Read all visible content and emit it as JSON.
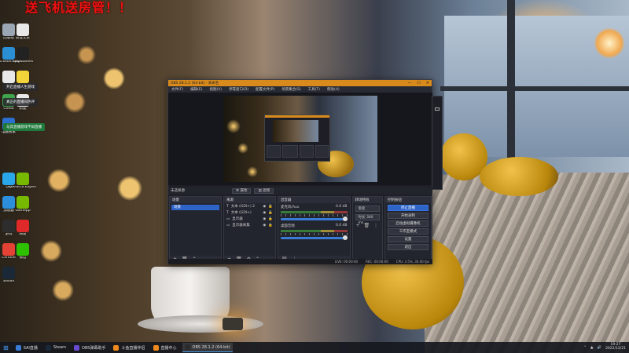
{
  "desktop": {
    "banner": "送飞机送房管！！",
    "icons": [
      {
        "label": "回收站",
        "color": "#9aa6b4"
      },
      {
        "label": "新建文本",
        "color": "#e8e8e8"
      },
      {
        "label": "Microsoft Edge",
        "color": "#2b8fd6"
      },
      {
        "label": "Epic Games",
        "color": "#222222"
      },
      {
        "label": "文件",
        "color": "#e8e8e8"
      },
      {
        "label": "文件",
        "color": "#f2d33a"
      },
      {
        "label": "Cheat",
        "color": "#3fa34d"
      },
      {
        "label": "新建",
        "color": "#e8e8e8"
      },
      {
        "label": "电脑管家",
        "color": "#2c6fcf"
      },
      {
        "label": "QQ",
        "color": "#2aa7e8"
      },
      {
        "label": "GeForce Experience",
        "color": "#76b900"
      },
      {
        "label": "加速器",
        "color": "#2d8fdc"
      },
      {
        "label": "Gamepp",
        "color": "#76b900"
      },
      {
        "label": "游戏",
        "color": "#2d2d2d"
      },
      {
        "label": "网易",
        "color": "#e02a2a"
      },
      {
        "label": "Chrome",
        "color": "#e34234"
      },
      {
        "label": "微信",
        "color": "#2dc100"
      },
      {
        "label": "Steam",
        "color": "#1b2838"
      }
    ],
    "notifications": [
      {
        "text": "开启直播人生游戏",
        "on": false
      },
      {
        "text": "真正的直播间热评",
        "on": false
      },
      {
        "text": "与其直播游戏不如直播",
        "on": true
      }
    ]
  },
  "obs": {
    "title": "OBS 28.1.2 (64-bit) - 未命名",
    "window_controls": [
      "—",
      "☐",
      "✕"
    ],
    "menu": [
      "文件(F)",
      "编辑(E)",
      "视图(V)",
      "停靠窗口(D)",
      "配置文件(P)",
      "场景集合(S)",
      "工具(T)",
      "帮助(H)"
    ],
    "scene_label": "未选择源",
    "toolbar_buttons": [
      "属性",
      "滤镜"
    ],
    "docks": {
      "scenes": {
        "title": "场景",
        "items": [
          "场景"
        ]
      },
      "sources": {
        "title": "来源",
        "items": [
          "文本 (GDI+) 2",
          "文本 (GDI+)",
          "显示器",
          "显示器采集"
        ]
      },
      "mixer": {
        "title": "混音器",
        "channels": [
          {
            "name": "麦克风/Aux",
            "db": "0.0 dB"
          },
          {
            "name": "桌面音频",
            "db": "0.0 dB"
          }
        ]
      },
      "transitions": {
        "title": "转场特效",
        "type": "渐变",
        "duration_label": "时长",
        "duration": "300 ms"
      },
      "controls": {
        "title": "控制按钮",
        "buttons": [
          "停止直播",
          "开始录制",
          "启动虚拟摄像机",
          "工作室模式",
          "设置",
          "退出"
        ]
      }
    },
    "status": {
      "live": "LIVE: 00:00:00",
      "rec": "REC: 00:00:00",
      "cpu": "CPU: 3.5%, 30.00 fps"
    }
  },
  "taskbar": {
    "items": [
      {
        "label": "SAI直播",
        "color": "#3a7bd5",
        "active": false
      },
      {
        "label": "Steam",
        "color": "#1b2838",
        "active": false
      },
      {
        "label": "OBS弹幕助手",
        "color": "#6a4ad1",
        "active": false
      },
      {
        "label": "斗鱼直播伴侣",
        "color": "#f08a1c",
        "active": false
      },
      {
        "label": "直播中心",
        "color": "#f08a1c",
        "active": false
      },
      {
        "label": "OBS 28.1.2 (64-bit)",
        "color": "#2c2c2c",
        "active": true
      }
    ],
    "time": "19:27",
    "date": "2022/12/21"
  },
  "colors": {
    "obs_titlebar": "#d88a1c",
    "accent": "#2e63c8"
  }
}
